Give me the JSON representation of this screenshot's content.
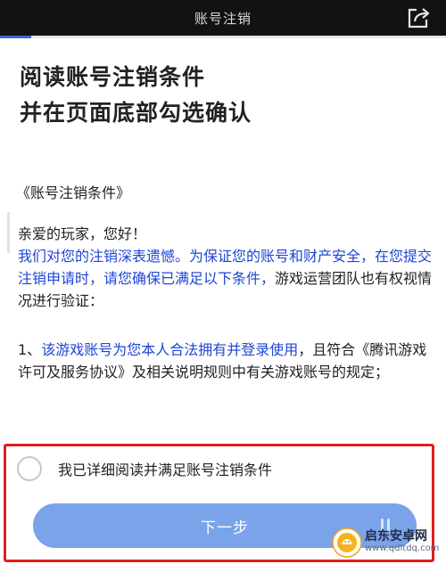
{
  "topbar": {
    "title": "账号注销",
    "share_icon": "share-icon"
  },
  "progress": {
    "fraction": 0.07,
    "color": "#3f65d8"
  },
  "heading": {
    "line1": "阅读账号注销条件",
    "line2": "并在页面底部勾选确认"
  },
  "document": {
    "title": "《账号注销条件》",
    "greeting": "亲爱的玩家，您好！",
    "intro_blue": "我们对您的注销深表遗憾。为保证您的账号和财产安全，在您提交注销申请时，请您确保已满足以下条件，",
    "intro_rest": "游戏运营团队也有权视情况进行验证：",
    "item1_prefix": "1、",
    "item1_blue": "该游戏账号为您本人合法拥有并登录使用",
    "item1_rest": "，且符合《腾讯游戏许可及服务协议》及相关说明规则中有关游戏账号的规定；"
  },
  "confirm": {
    "checkbox_label": "我已详细阅读并满足账号注销条件",
    "checked": false,
    "next_label": "下一步"
  },
  "watermark": {
    "name": "启东安卓网",
    "url": "www.qdltdq.com"
  },
  "colors": {
    "accent_blue": "#1f45d6",
    "button": "#7aa3ea",
    "highlight_border": "#e02020"
  }
}
